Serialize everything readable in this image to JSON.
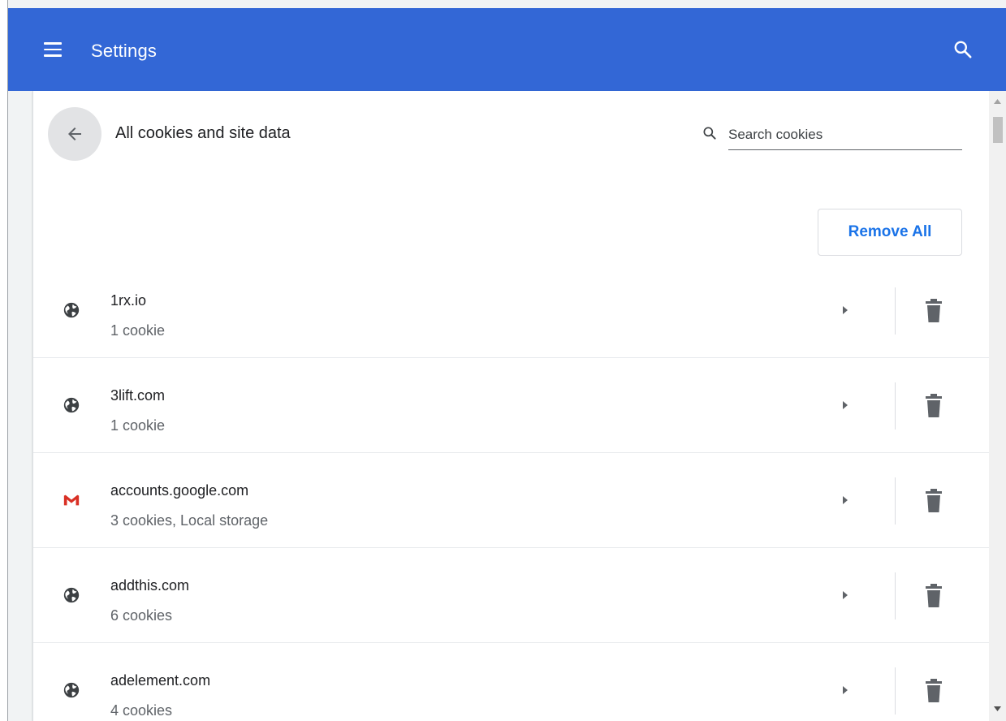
{
  "header": {
    "title": "Settings",
    "menu_icon": "hamburger-menu-icon",
    "search_icon": "search-icon",
    "color": "#3367d6"
  },
  "subpage": {
    "title": "All cookies and site data",
    "back_icon": "arrow-back-icon",
    "search": {
      "placeholder": "Search cookies",
      "value": ""
    },
    "remove_all_label": "Remove All",
    "accent": "#1a73e8"
  },
  "sites": [
    {
      "name": "1rx.io",
      "detail": "1 cookie",
      "icon": "globe-icon"
    },
    {
      "name": "3lift.com",
      "detail": "1 cookie",
      "icon": "globe-icon"
    },
    {
      "name": "accounts.google.com",
      "detail": "3 cookies, Local storage",
      "icon": "gmail-icon"
    },
    {
      "name": "addthis.com",
      "detail": "6 cookies",
      "icon": "globe-icon"
    },
    {
      "name": "adelement.com",
      "detail": "4 cookies",
      "icon": "globe-icon"
    }
  ]
}
